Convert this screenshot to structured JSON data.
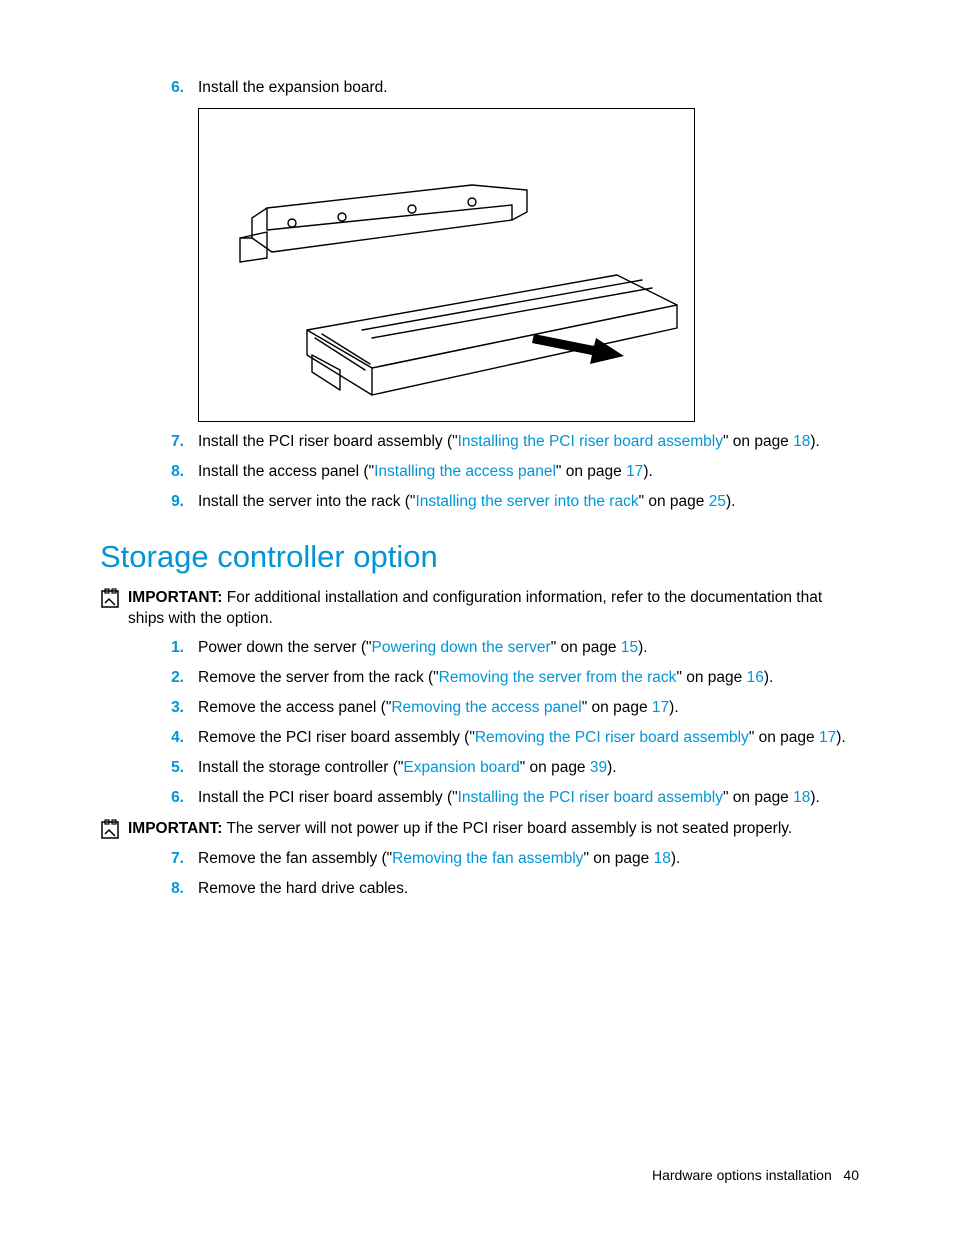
{
  "top_list": [
    {
      "num": "6.",
      "pre": "Install the expansion board.",
      "link": null,
      "post": null,
      "page": null
    }
  ],
  "mid_list": [
    {
      "num": "7.",
      "pre": "Install the PCI riser board assembly (\"",
      "link": "Installing the PCI riser board assembly",
      "post": "\" on page ",
      "page": "18",
      "tail": ")."
    },
    {
      "num": "8.",
      "pre": "Install the access panel (\"",
      "link": "Installing the access panel",
      "post": "\" on page ",
      "page": "17",
      "tail": ")."
    },
    {
      "num": "9.",
      "pre": "Install the server into the rack (\"",
      "link": "Installing the server into the rack",
      "post": "\" on page ",
      "page": "25",
      "tail": ")."
    }
  ],
  "section_heading": "Storage controller option",
  "important1": {
    "label": "IMPORTANT:",
    "text": "  For additional installation and configuration information, refer to the documentation that ships with the option."
  },
  "steps_a": [
    {
      "num": "1.",
      "pre": "Power down the server (\"",
      "link": "Powering down the server",
      "post": "\" on page ",
      "page": "15",
      "tail": ")."
    },
    {
      "num": "2.",
      "pre": "Remove the server from the rack (\"",
      "link": "Removing the server from the rack",
      "post": "\" on page ",
      "page": "16",
      "tail": ")."
    },
    {
      "num": "3.",
      "pre": "Remove the access panel (\"",
      "link": "Removing the access panel",
      "post": "\" on page ",
      "page": "17",
      "tail": ")."
    },
    {
      "num": "4.",
      "pre": "Remove the PCI riser board assembly (\"",
      "link": "Removing the PCI riser board assembly",
      "post": "\" on page ",
      "page": "17",
      "tail": ")."
    },
    {
      "num": "5.",
      "pre": "Install the storage controller (\"",
      "link": "Expansion board",
      "post": "\" on page ",
      "page": "39",
      "tail": ")."
    },
    {
      "num": "6.",
      "pre": "Install the PCI riser board assembly (\"",
      "link": "Installing the PCI riser board assembly",
      "post": "\" on page ",
      "page": "18",
      "tail": ")."
    }
  ],
  "important2": {
    "label": "IMPORTANT:",
    "text": "  The server will not power up if the PCI riser board assembly is not seated properly."
  },
  "steps_b": [
    {
      "num": "7.",
      "pre": "Remove the fan assembly (\"",
      "link": "Removing the fan assembly",
      "post": "\" on page ",
      "page": "18",
      "tail": ")."
    },
    {
      "num": "8.",
      "pre": "Remove the hard drive cables.",
      "link": null,
      "post": null,
      "page": null,
      "tail": null
    }
  ],
  "footer": {
    "section": "Hardware options installation",
    "page": "40"
  }
}
